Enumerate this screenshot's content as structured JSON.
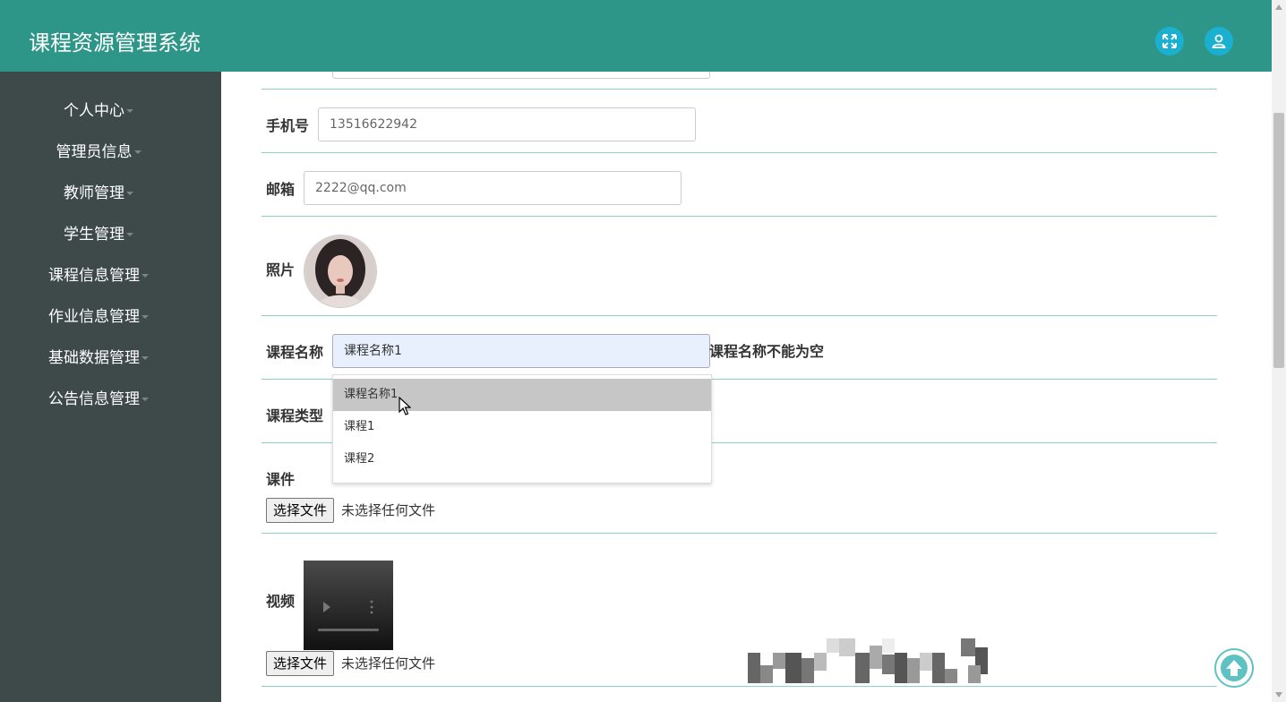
{
  "header": {
    "title": "课程资源管理系统"
  },
  "sidebar": {
    "items": [
      {
        "label": "个人中心"
      },
      {
        "label": "管理员信息"
      },
      {
        "label": "教师管理"
      },
      {
        "label": "学生管理"
      },
      {
        "label": "课程信息管理"
      },
      {
        "label": "作业信息管理"
      },
      {
        "label": "基础数据管理"
      },
      {
        "label": "公告信息管理"
      }
    ]
  },
  "form": {
    "phone": {
      "label": "手机号",
      "value": "13516622942"
    },
    "email": {
      "label": "邮箱",
      "value": "2222@qq.com"
    },
    "photo": {
      "label": "照片"
    },
    "course_name": {
      "label": "课程名称",
      "value": "课程名称1",
      "error": "课程名称不能为空"
    },
    "course_type": {
      "label": "课程类型"
    },
    "courseware": {
      "label": "课件",
      "button": "选择文件",
      "status": "未选择任何文件"
    },
    "video": {
      "label": "视频",
      "button": "选择文件",
      "status": "未选择任何文件"
    }
  },
  "dropdown": {
    "options": [
      "课程名称1",
      "课程1",
      "课程2"
    ],
    "highlighted": "课程名称1"
  },
  "colors": {
    "header": "#2e9688",
    "sidebar": "#3e4a4a",
    "icon_button": "#1cb0d0",
    "divider": "#8fcfc4"
  }
}
